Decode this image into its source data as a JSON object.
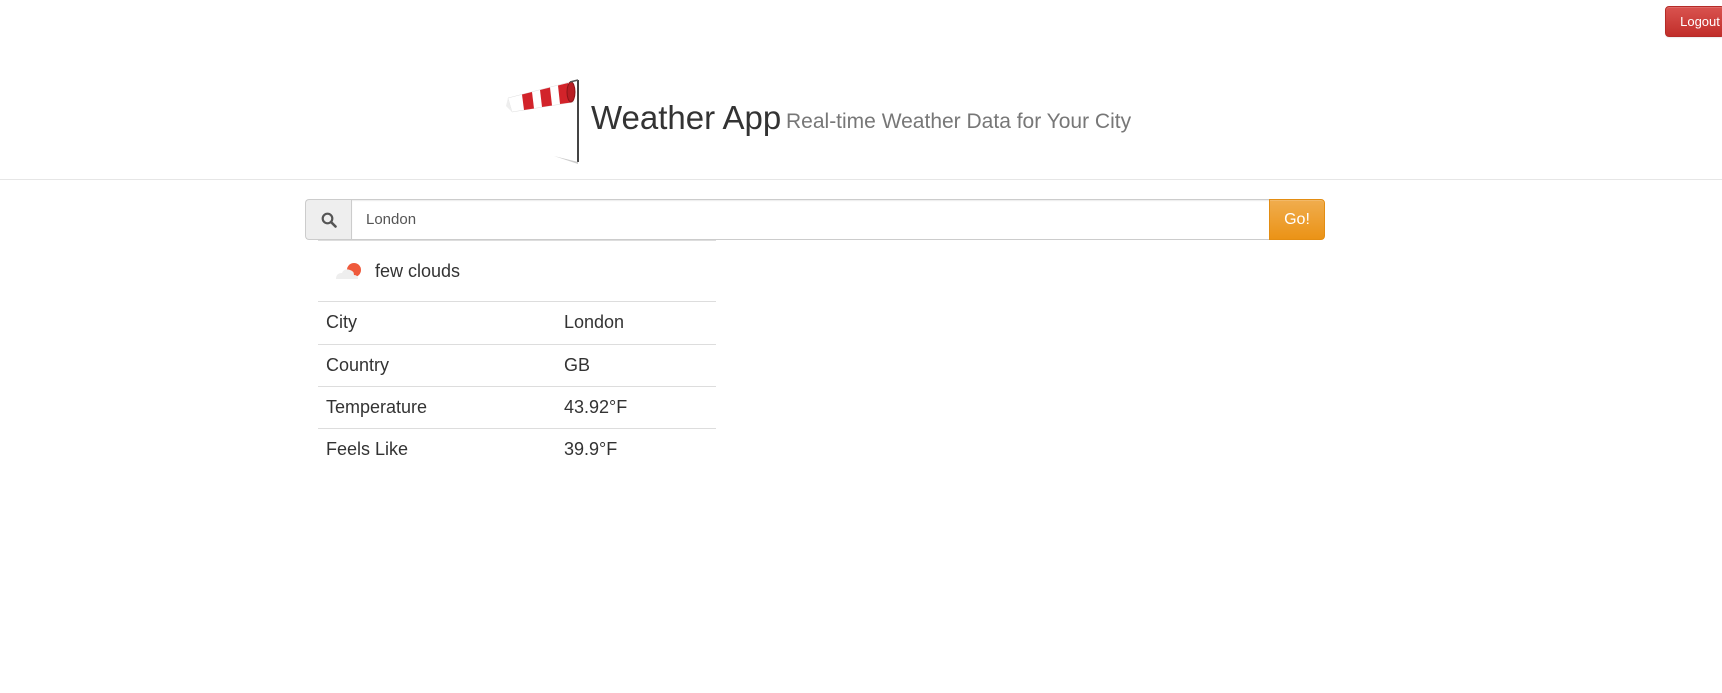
{
  "header": {
    "logout_label": "Logout",
    "title": "Weather App",
    "subtitle": "Real-time Weather Data for Your City"
  },
  "search": {
    "value": "London",
    "go_label": "Go!"
  },
  "weather": {
    "condition": "few clouds",
    "rows": [
      {
        "label": "City",
        "value": "London"
      },
      {
        "label": "Country",
        "value": "GB"
      },
      {
        "label": "Temperature",
        "value": "43.92°F"
      },
      {
        "label": "Feels Like",
        "value": "39.9°F"
      }
    ]
  },
  "colors": {
    "logout": "#d9534f",
    "go": "#f0ad4e",
    "sock_red": "#d2232a"
  },
  "icons": {
    "logo": "windsock-icon",
    "search": "search-icon",
    "weather": "few-clouds-icon"
  }
}
